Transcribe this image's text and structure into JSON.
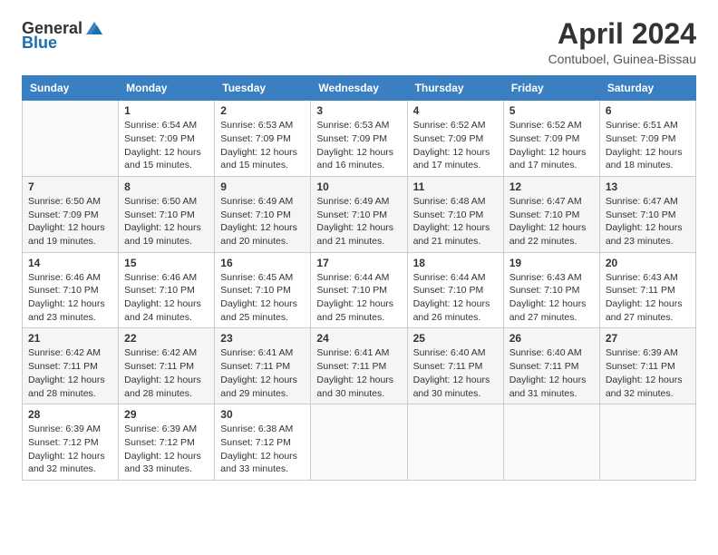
{
  "header": {
    "logo_general": "General",
    "logo_blue": "Blue",
    "title": "April 2024",
    "subtitle": "Contuboel, Guinea-Bissau"
  },
  "calendar": {
    "days_of_week": [
      "Sunday",
      "Monday",
      "Tuesday",
      "Wednesday",
      "Thursday",
      "Friday",
      "Saturday"
    ],
    "weeks": [
      [
        {
          "day": "",
          "info": ""
        },
        {
          "day": "1",
          "info": "Sunrise: 6:54 AM\nSunset: 7:09 PM\nDaylight: 12 hours\nand 15 minutes."
        },
        {
          "day": "2",
          "info": "Sunrise: 6:53 AM\nSunset: 7:09 PM\nDaylight: 12 hours\nand 15 minutes."
        },
        {
          "day": "3",
          "info": "Sunrise: 6:53 AM\nSunset: 7:09 PM\nDaylight: 12 hours\nand 16 minutes."
        },
        {
          "day": "4",
          "info": "Sunrise: 6:52 AM\nSunset: 7:09 PM\nDaylight: 12 hours\nand 17 minutes."
        },
        {
          "day": "5",
          "info": "Sunrise: 6:52 AM\nSunset: 7:09 PM\nDaylight: 12 hours\nand 17 minutes."
        },
        {
          "day": "6",
          "info": "Sunrise: 6:51 AM\nSunset: 7:09 PM\nDaylight: 12 hours\nand 18 minutes."
        }
      ],
      [
        {
          "day": "7",
          "info": "Sunrise: 6:50 AM\nSunset: 7:09 PM\nDaylight: 12 hours\nand 19 minutes."
        },
        {
          "day": "8",
          "info": "Sunrise: 6:50 AM\nSunset: 7:10 PM\nDaylight: 12 hours\nand 19 minutes."
        },
        {
          "day": "9",
          "info": "Sunrise: 6:49 AM\nSunset: 7:10 PM\nDaylight: 12 hours\nand 20 minutes."
        },
        {
          "day": "10",
          "info": "Sunrise: 6:49 AM\nSunset: 7:10 PM\nDaylight: 12 hours\nand 21 minutes."
        },
        {
          "day": "11",
          "info": "Sunrise: 6:48 AM\nSunset: 7:10 PM\nDaylight: 12 hours\nand 21 minutes."
        },
        {
          "day": "12",
          "info": "Sunrise: 6:47 AM\nSunset: 7:10 PM\nDaylight: 12 hours\nand 22 minutes."
        },
        {
          "day": "13",
          "info": "Sunrise: 6:47 AM\nSunset: 7:10 PM\nDaylight: 12 hours\nand 23 minutes."
        }
      ],
      [
        {
          "day": "14",
          "info": "Sunrise: 6:46 AM\nSunset: 7:10 PM\nDaylight: 12 hours\nand 23 minutes."
        },
        {
          "day": "15",
          "info": "Sunrise: 6:46 AM\nSunset: 7:10 PM\nDaylight: 12 hours\nand 24 minutes."
        },
        {
          "day": "16",
          "info": "Sunrise: 6:45 AM\nSunset: 7:10 PM\nDaylight: 12 hours\nand 25 minutes."
        },
        {
          "day": "17",
          "info": "Sunrise: 6:44 AM\nSunset: 7:10 PM\nDaylight: 12 hours\nand 25 minutes."
        },
        {
          "day": "18",
          "info": "Sunrise: 6:44 AM\nSunset: 7:10 PM\nDaylight: 12 hours\nand 26 minutes."
        },
        {
          "day": "19",
          "info": "Sunrise: 6:43 AM\nSunset: 7:10 PM\nDaylight: 12 hours\nand 27 minutes."
        },
        {
          "day": "20",
          "info": "Sunrise: 6:43 AM\nSunset: 7:11 PM\nDaylight: 12 hours\nand 27 minutes."
        }
      ],
      [
        {
          "day": "21",
          "info": "Sunrise: 6:42 AM\nSunset: 7:11 PM\nDaylight: 12 hours\nand 28 minutes."
        },
        {
          "day": "22",
          "info": "Sunrise: 6:42 AM\nSunset: 7:11 PM\nDaylight: 12 hours\nand 28 minutes."
        },
        {
          "day": "23",
          "info": "Sunrise: 6:41 AM\nSunset: 7:11 PM\nDaylight: 12 hours\nand 29 minutes."
        },
        {
          "day": "24",
          "info": "Sunrise: 6:41 AM\nSunset: 7:11 PM\nDaylight: 12 hours\nand 30 minutes."
        },
        {
          "day": "25",
          "info": "Sunrise: 6:40 AM\nSunset: 7:11 PM\nDaylight: 12 hours\nand 30 minutes."
        },
        {
          "day": "26",
          "info": "Sunrise: 6:40 AM\nSunset: 7:11 PM\nDaylight: 12 hours\nand 31 minutes."
        },
        {
          "day": "27",
          "info": "Sunrise: 6:39 AM\nSunset: 7:11 PM\nDaylight: 12 hours\nand 32 minutes."
        }
      ],
      [
        {
          "day": "28",
          "info": "Sunrise: 6:39 AM\nSunset: 7:12 PM\nDaylight: 12 hours\nand 32 minutes."
        },
        {
          "day": "29",
          "info": "Sunrise: 6:39 AM\nSunset: 7:12 PM\nDaylight: 12 hours\nand 33 minutes."
        },
        {
          "day": "30",
          "info": "Sunrise: 6:38 AM\nSunset: 7:12 PM\nDaylight: 12 hours\nand 33 minutes."
        },
        {
          "day": "",
          "info": ""
        },
        {
          "day": "",
          "info": ""
        },
        {
          "day": "",
          "info": ""
        },
        {
          "day": "",
          "info": ""
        }
      ]
    ]
  }
}
